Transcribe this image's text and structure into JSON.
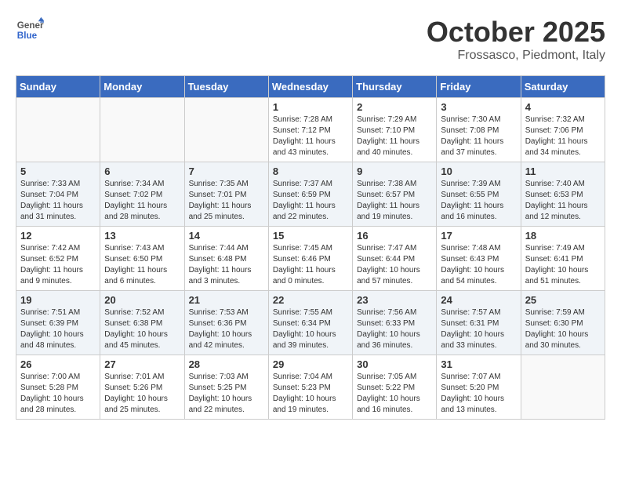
{
  "header": {
    "logo_general": "General",
    "logo_blue": "Blue",
    "month": "October 2025",
    "location": "Frossasco, Piedmont, Italy"
  },
  "weekdays": [
    "Sunday",
    "Monday",
    "Tuesday",
    "Wednesday",
    "Thursday",
    "Friday",
    "Saturday"
  ],
  "weeks": [
    [
      {
        "day": "",
        "info": ""
      },
      {
        "day": "",
        "info": ""
      },
      {
        "day": "",
        "info": ""
      },
      {
        "day": "1",
        "info": "Sunrise: 7:28 AM\nSunset: 7:12 PM\nDaylight: 11 hours\nand 43 minutes."
      },
      {
        "day": "2",
        "info": "Sunrise: 7:29 AM\nSunset: 7:10 PM\nDaylight: 11 hours\nand 40 minutes."
      },
      {
        "day": "3",
        "info": "Sunrise: 7:30 AM\nSunset: 7:08 PM\nDaylight: 11 hours\nand 37 minutes."
      },
      {
        "day": "4",
        "info": "Sunrise: 7:32 AM\nSunset: 7:06 PM\nDaylight: 11 hours\nand 34 minutes."
      }
    ],
    [
      {
        "day": "5",
        "info": "Sunrise: 7:33 AM\nSunset: 7:04 PM\nDaylight: 11 hours\nand 31 minutes."
      },
      {
        "day": "6",
        "info": "Sunrise: 7:34 AM\nSunset: 7:02 PM\nDaylight: 11 hours\nand 28 minutes."
      },
      {
        "day": "7",
        "info": "Sunrise: 7:35 AM\nSunset: 7:01 PM\nDaylight: 11 hours\nand 25 minutes."
      },
      {
        "day": "8",
        "info": "Sunrise: 7:37 AM\nSunset: 6:59 PM\nDaylight: 11 hours\nand 22 minutes."
      },
      {
        "day": "9",
        "info": "Sunrise: 7:38 AM\nSunset: 6:57 PM\nDaylight: 11 hours\nand 19 minutes."
      },
      {
        "day": "10",
        "info": "Sunrise: 7:39 AM\nSunset: 6:55 PM\nDaylight: 11 hours\nand 16 minutes."
      },
      {
        "day": "11",
        "info": "Sunrise: 7:40 AM\nSunset: 6:53 PM\nDaylight: 11 hours\nand 12 minutes."
      }
    ],
    [
      {
        "day": "12",
        "info": "Sunrise: 7:42 AM\nSunset: 6:52 PM\nDaylight: 11 hours\nand 9 minutes."
      },
      {
        "day": "13",
        "info": "Sunrise: 7:43 AM\nSunset: 6:50 PM\nDaylight: 11 hours\nand 6 minutes."
      },
      {
        "day": "14",
        "info": "Sunrise: 7:44 AM\nSunset: 6:48 PM\nDaylight: 11 hours\nand 3 minutes."
      },
      {
        "day": "15",
        "info": "Sunrise: 7:45 AM\nSunset: 6:46 PM\nDaylight: 11 hours\nand 0 minutes."
      },
      {
        "day": "16",
        "info": "Sunrise: 7:47 AM\nSunset: 6:44 PM\nDaylight: 10 hours\nand 57 minutes."
      },
      {
        "day": "17",
        "info": "Sunrise: 7:48 AM\nSunset: 6:43 PM\nDaylight: 10 hours\nand 54 minutes."
      },
      {
        "day": "18",
        "info": "Sunrise: 7:49 AM\nSunset: 6:41 PM\nDaylight: 10 hours\nand 51 minutes."
      }
    ],
    [
      {
        "day": "19",
        "info": "Sunrise: 7:51 AM\nSunset: 6:39 PM\nDaylight: 10 hours\nand 48 minutes."
      },
      {
        "day": "20",
        "info": "Sunrise: 7:52 AM\nSunset: 6:38 PM\nDaylight: 10 hours\nand 45 minutes."
      },
      {
        "day": "21",
        "info": "Sunrise: 7:53 AM\nSunset: 6:36 PM\nDaylight: 10 hours\nand 42 minutes."
      },
      {
        "day": "22",
        "info": "Sunrise: 7:55 AM\nSunset: 6:34 PM\nDaylight: 10 hours\nand 39 minutes."
      },
      {
        "day": "23",
        "info": "Sunrise: 7:56 AM\nSunset: 6:33 PM\nDaylight: 10 hours\nand 36 minutes."
      },
      {
        "day": "24",
        "info": "Sunrise: 7:57 AM\nSunset: 6:31 PM\nDaylight: 10 hours\nand 33 minutes."
      },
      {
        "day": "25",
        "info": "Sunrise: 7:59 AM\nSunset: 6:30 PM\nDaylight: 10 hours\nand 30 minutes."
      }
    ],
    [
      {
        "day": "26",
        "info": "Sunrise: 7:00 AM\nSunset: 5:28 PM\nDaylight: 10 hours\nand 28 minutes."
      },
      {
        "day": "27",
        "info": "Sunrise: 7:01 AM\nSunset: 5:26 PM\nDaylight: 10 hours\nand 25 minutes."
      },
      {
        "day": "28",
        "info": "Sunrise: 7:03 AM\nSunset: 5:25 PM\nDaylight: 10 hours\nand 22 minutes."
      },
      {
        "day": "29",
        "info": "Sunrise: 7:04 AM\nSunset: 5:23 PM\nDaylight: 10 hours\nand 19 minutes."
      },
      {
        "day": "30",
        "info": "Sunrise: 7:05 AM\nSunset: 5:22 PM\nDaylight: 10 hours\nand 16 minutes."
      },
      {
        "day": "31",
        "info": "Sunrise: 7:07 AM\nSunset: 5:20 PM\nDaylight: 10 hours\nand 13 minutes."
      },
      {
        "day": "",
        "info": ""
      }
    ]
  ]
}
